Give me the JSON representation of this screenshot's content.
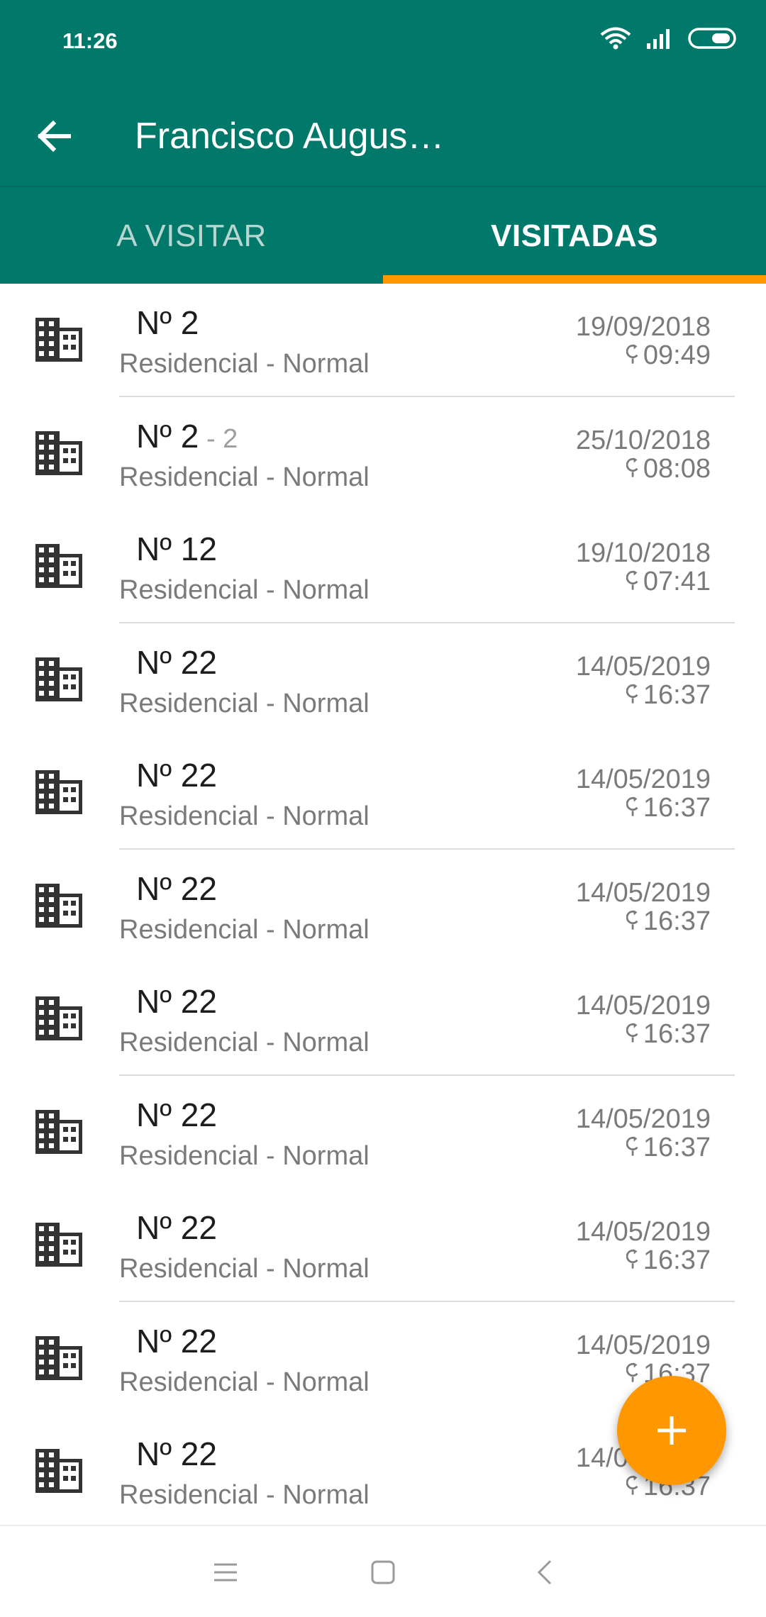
{
  "status_bar": {
    "time": "11:26"
  },
  "toolbar": {
    "title": "Francisco Augus…",
    "back_icon": "arrow-left-icon"
  },
  "tabs": [
    {
      "label": "A VISITAR",
      "selected": false
    },
    {
      "label": "VISITADAS",
      "selected": true
    }
  ],
  "colors": {
    "primary": "#00786a",
    "accent": "#ff9800"
  },
  "items": [
    {
      "number": "Nº 2",
      "suffix": "",
      "type": "Residencial - Normal",
      "date": "19/09/2018",
      "time": "09:49"
    },
    {
      "number": "Nº 2",
      "suffix": " - 2",
      "type": "Residencial - Normal",
      "date": "25/10/2018",
      "time": "08:08"
    },
    {
      "number": "Nº 12",
      "suffix": "",
      "type": "Residencial - Normal",
      "date": "19/10/2018",
      "time": "07:41"
    },
    {
      "number": "Nº 22",
      "suffix": "",
      "type": "Residencial - Normal",
      "date": "14/05/2019",
      "time": "16:37"
    },
    {
      "number": "Nº 22",
      "suffix": "",
      "type": "Residencial - Normal",
      "date": "14/05/2019",
      "time": "16:37"
    },
    {
      "number": "Nº 22",
      "suffix": "",
      "type": "Residencial - Normal",
      "date": "14/05/2019",
      "time": "16:37"
    },
    {
      "number": "Nº 22",
      "suffix": "",
      "type": "Residencial - Normal",
      "date": "14/05/2019",
      "time": "16:37"
    },
    {
      "number": "Nº 22",
      "suffix": "",
      "type": "Residencial - Normal",
      "date": "14/05/2019",
      "time": "16:37"
    },
    {
      "number": "Nº 22",
      "suffix": "",
      "type": "Residencial - Normal",
      "date": "14/05/2019",
      "time": "16:37"
    },
    {
      "number": "Nº 22",
      "suffix": "",
      "type": "Residencial - Normal",
      "date": "14/05/2019",
      "time": "16:37"
    },
    {
      "number": "Nº 22",
      "suffix": "",
      "type": "Residencial - Normal",
      "date": "14/05/2019",
      "time": "16:37"
    }
  ],
  "fab": {
    "icon": "plus-icon"
  },
  "nav": {
    "icons": [
      "menu-icon",
      "home-square-icon",
      "back-chevron-icon"
    ]
  }
}
